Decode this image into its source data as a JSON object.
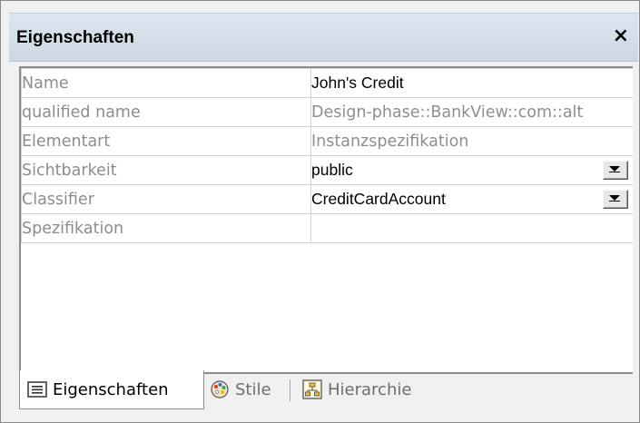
{
  "panel": {
    "title": "Eigenschaften",
    "close_glyph": "×"
  },
  "properties": [
    {
      "label": "Name",
      "value": "John's Credit",
      "style": "strong",
      "dropdown": false
    },
    {
      "label": "qualified name",
      "value": "Design-phase::BankView::com::alt",
      "style": "dim",
      "dropdown": false
    },
    {
      "label": "Elementart",
      "value": "Instanzspezifikation",
      "style": "dim",
      "dropdown": false
    },
    {
      "label": "Sichtbarkeit",
      "value": "public",
      "style": "strong",
      "dropdown": true
    },
    {
      "label": "Classifier",
      "value": "CreditCardAccount",
      "style": "strong",
      "dropdown": true
    },
    {
      "label": "Spezifikation",
      "value": "",
      "style": "strong",
      "dropdown": false
    }
  ],
  "tabs": [
    {
      "label": "Eigenschaften",
      "icon": "properties-list-icon",
      "active": true
    },
    {
      "label": "Stile",
      "icon": "palette-icon",
      "active": false
    },
    {
      "label": "Hierarchie",
      "icon": "hierarchy-icon",
      "active": false
    }
  ]
}
